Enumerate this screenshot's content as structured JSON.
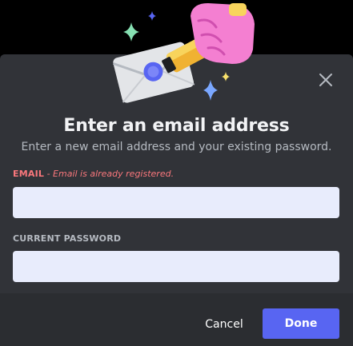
{
  "dialog": {
    "title": "Enter an email address",
    "subtitle": "Enter a new email address and your existing password.",
    "close_icon": "close-icon"
  },
  "email_field": {
    "label": "EMAIL",
    "error": " - Email is already registered.",
    "value": "",
    "placeholder": ""
  },
  "password_field": {
    "label": "CURRENT PASSWORD",
    "value": "",
    "placeholder": ""
  },
  "footer": {
    "cancel_label": "Cancel",
    "done_label": "Done"
  },
  "colors": {
    "modal_background": "#313338",
    "footer_background": "#2b2d31",
    "input_background": "#e8ecfc",
    "error": "#fa777c",
    "brand": "#5865f2"
  },
  "icons": {
    "illustration": "envelope-hand-illustration",
    "close": "close-icon"
  }
}
